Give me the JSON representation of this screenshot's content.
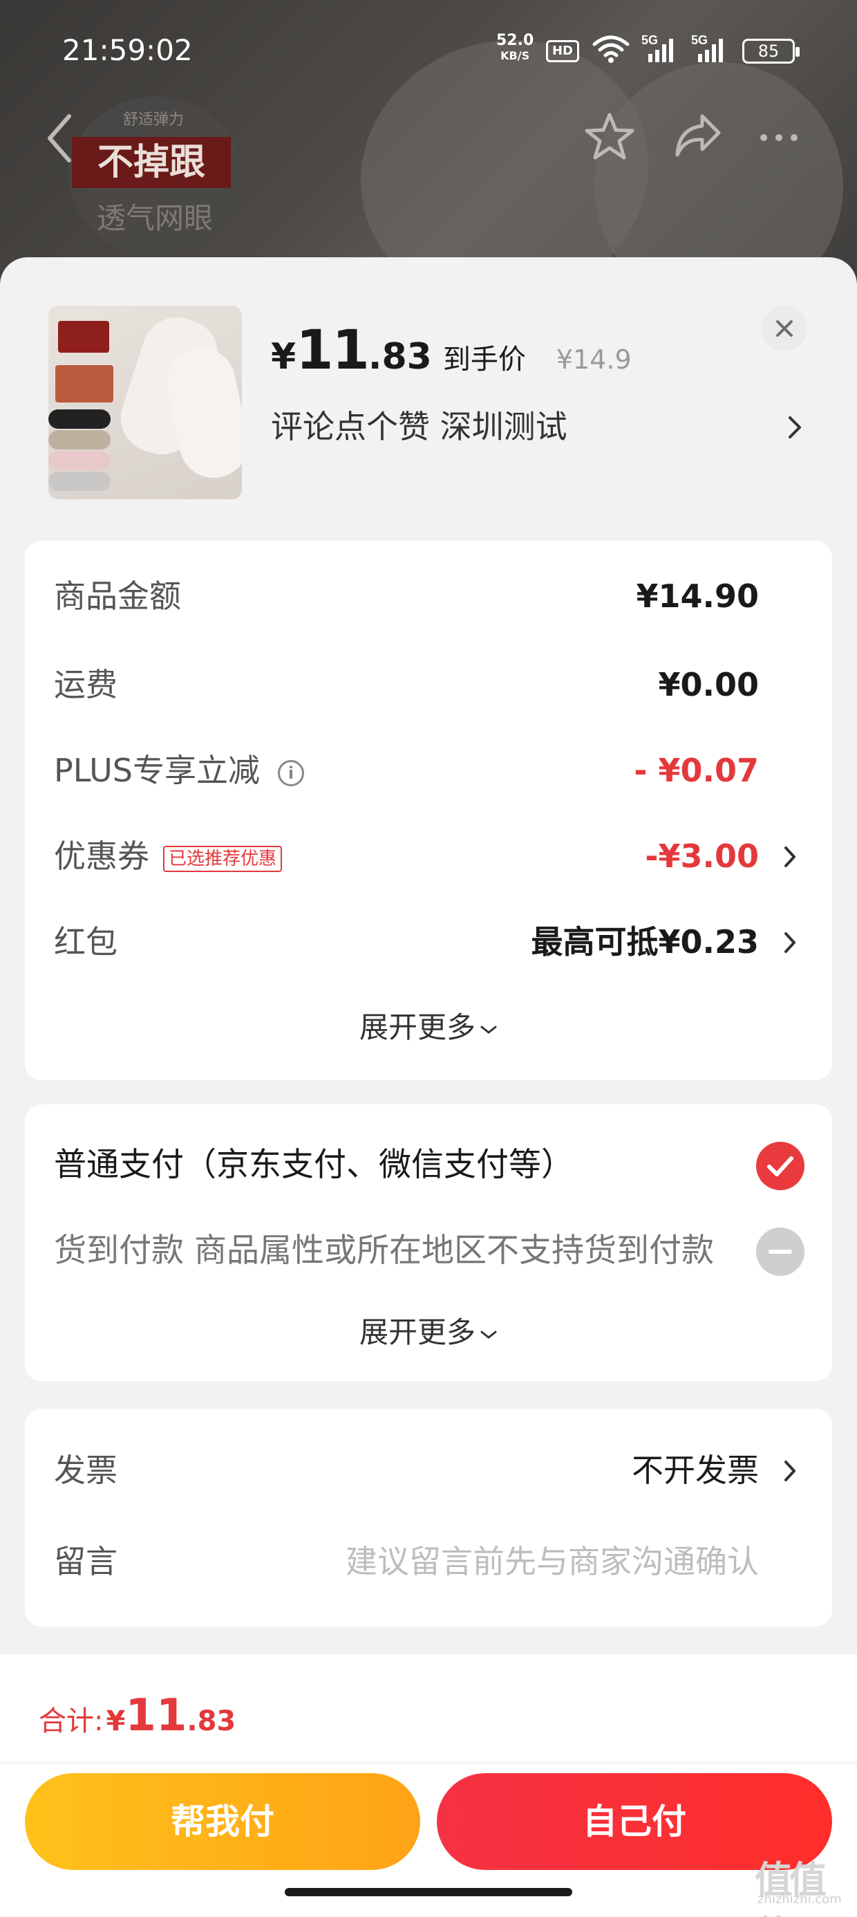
{
  "status_bar": {
    "time": "21:59:02",
    "speed_value": "52.0",
    "speed_unit": "KB/S",
    "hd_label": "HD",
    "network_1": "5G",
    "network_2": "5G",
    "battery": "85"
  },
  "background": {
    "promo_sub": "舒适弹力",
    "promo_main": "不掉跟",
    "promo_bottom": "透气网眼"
  },
  "product": {
    "price_symbol": "¥",
    "price_integer": "11",
    "price_decimal": ".83",
    "price_tag": "到手价",
    "original_price": "¥14.9",
    "spec": "评论点个赞  深圳测试"
  },
  "summary": {
    "rows": [
      {
        "label": "商品金额",
        "value": "¥14.90"
      },
      {
        "label": "运费",
        "value": "¥0.00"
      },
      {
        "label": "PLUS专享立减",
        "value": "- ¥0.07"
      },
      {
        "label": "优惠券",
        "badge": "已选推荐优惠",
        "value": "-¥3.00"
      },
      {
        "label": "红包",
        "value": "最高可抵¥0.23"
      }
    ],
    "expand_label": "展开更多"
  },
  "payment": {
    "options": [
      {
        "label": "普通支付（京东支付、微信支付等）",
        "selected": true
      },
      {
        "label": "货到付款 商品属性或所在地区不支持货到付款",
        "selected": false
      }
    ],
    "expand_label": "展开更多"
  },
  "extras": {
    "invoice_label": "发票",
    "invoice_value": "不开发票",
    "message_label": "留言",
    "message_placeholder": "建议留言前先与商家沟通确认"
  },
  "footer": {
    "total_label": "合计:",
    "total_symbol": "¥",
    "total_integer": "11",
    "total_decimal": ".83",
    "friend_pay_label": "帮我付",
    "self_pay_label": "自己付",
    "watermark": "值值值",
    "watermark_sub": "zhizhizhi.com"
  },
  "colors": {
    "accent_red": "#e4393c",
    "friend_button": "#ffb318",
    "self_button": "#f7303a"
  }
}
